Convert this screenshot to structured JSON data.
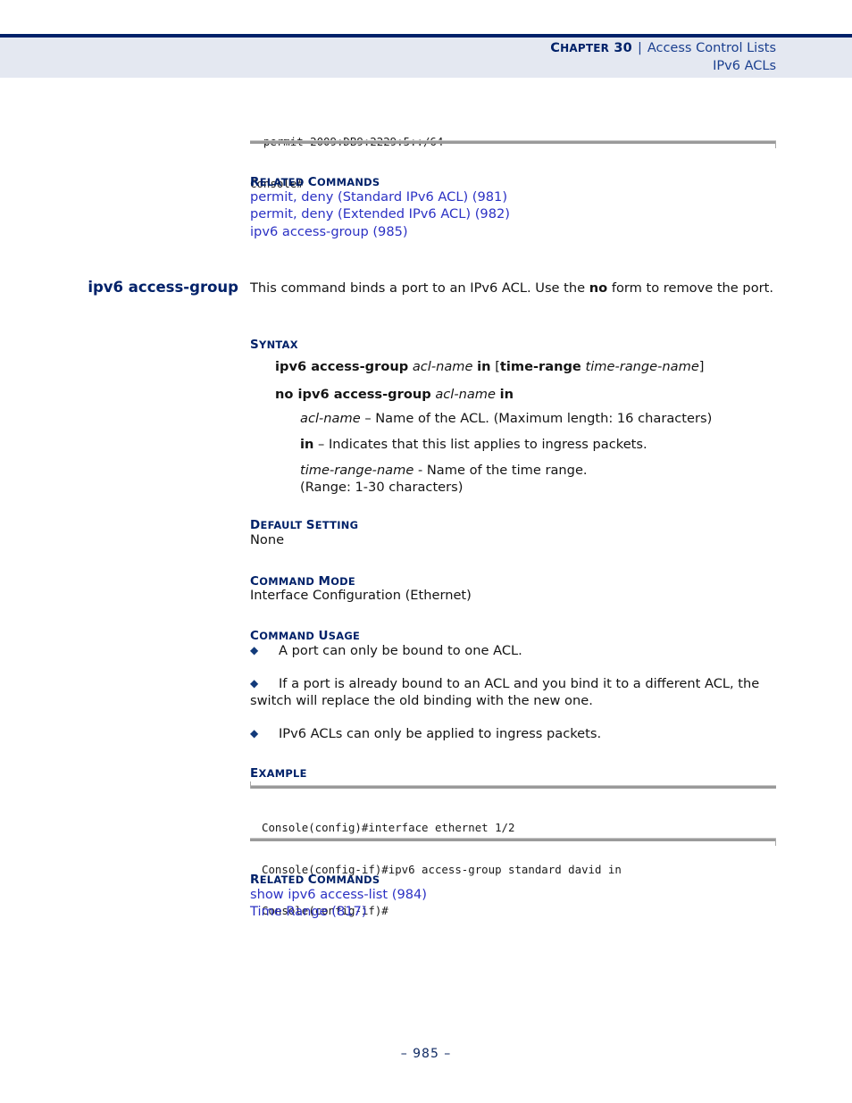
{
  "header": {
    "chapter_first": "C",
    "chapter_rest": "HAPTER",
    "chapter_number": "30",
    "separator": "|",
    "section_title": "Access Control Lists",
    "subsection_title": "IPv6 ACLs"
  },
  "top_code": {
    "lines": [
      "  permit 2009:DB9:2229:5::/64",
      "Console#"
    ]
  },
  "related_commands_top": {
    "heading_first": "R",
    "heading_rest": "ELATED",
    "heading_second_first": "C",
    "heading_second_rest": "OMMANDS",
    "links": [
      "permit, deny (Standard IPv6 ACL) (981)",
      "permit, deny (Extended IPv6 ACL) (982)",
      "ipv6 access-group (985)"
    ]
  },
  "command": {
    "name": "ipv6 access-group",
    "description_part1": "This command binds a port to an IPv6 ACL. Use the ",
    "description_bold": "no",
    "description_part2": " form to remove the port."
  },
  "syntax": {
    "heading_first": "S",
    "heading_rest": "YNTAX",
    "line1_bold1": "ipv6 access-group",
    "line1_italic1": "acl-name",
    "line1_bold2": "in",
    "line1_bracket_open": "[",
    "line1_bold3": "time-range",
    "line1_italic2": "time-range-name",
    "line1_bracket_close": "]",
    "line2_bold1": "no ipv6 access-group",
    "line2_italic1": "acl-name",
    "line2_bold2": "in",
    "params": [
      {
        "term": "acl-name",
        "term_style": "italic",
        "dash": "–",
        "text": "Name of the ACL. (Maximum length: 16 characters)",
        "text2": ""
      },
      {
        "term": "in",
        "term_style": "bold",
        "dash": "–",
        "text": "Indicates that this list applies to ingress packets.",
        "text2": ""
      },
      {
        "term": "time-range-name",
        "term_style": "italic",
        "dash": "-",
        "text": "Name of the time range.",
        "text2": "(Range: 1-30 characters)"
      }
    ]
  },
  "default_setting": {
    "heading_first": "D",
    "heading_rest": "EFAULT",
    "heading_second_first": "S",
    "heading_second_rest": "ETTING",
    "value": "None"
  },
  "command_mode": {
    "heading_first": "C",
    "heading_rest": "OMMAND",
    "heading_second_first": "M",
    "heading_second_rest": "ODE",
    "value": "Interface Configuration (Ethernet)"
  },
  "command_usage": {
    "heading_first": "C",
    "heading_rest": "OMMAND",
    "heading_second_first": "U",
    "heading_second_rest": "SAGE",
    "bullet_glyph": "◆",
    "items": [
      "A port can only be bound to one ACL.",
      "If a port is already bound to an ACL and you bind it to a different ACL, the switch will replace the old binding with the new one.",
      "IPv6 ACLs can only be applied to ingress packets."
    ]
  },
  "example": {
    "heading_first": "E",
    "heading_rest": "XAMPLE",
    "lines": [
      "Console(config)#interface ethernet 1/2",
      "Console(config-if)#ipv6 access-group standard david in",
      "Console(config-if)#"
    ]
  },
  "related_commands_bottom": {
    "heading_first": "R",
    "heading_rest": "ELATED",
    "heading_second_first": "C",
    "heading_second_rest": "OMMANDS",
    "links": [
      "show ipv6 access-list (984)",
      "Time Range (817)"
    ]
  },
  "footer": {
    "text": "–  985  –"
  }
}
